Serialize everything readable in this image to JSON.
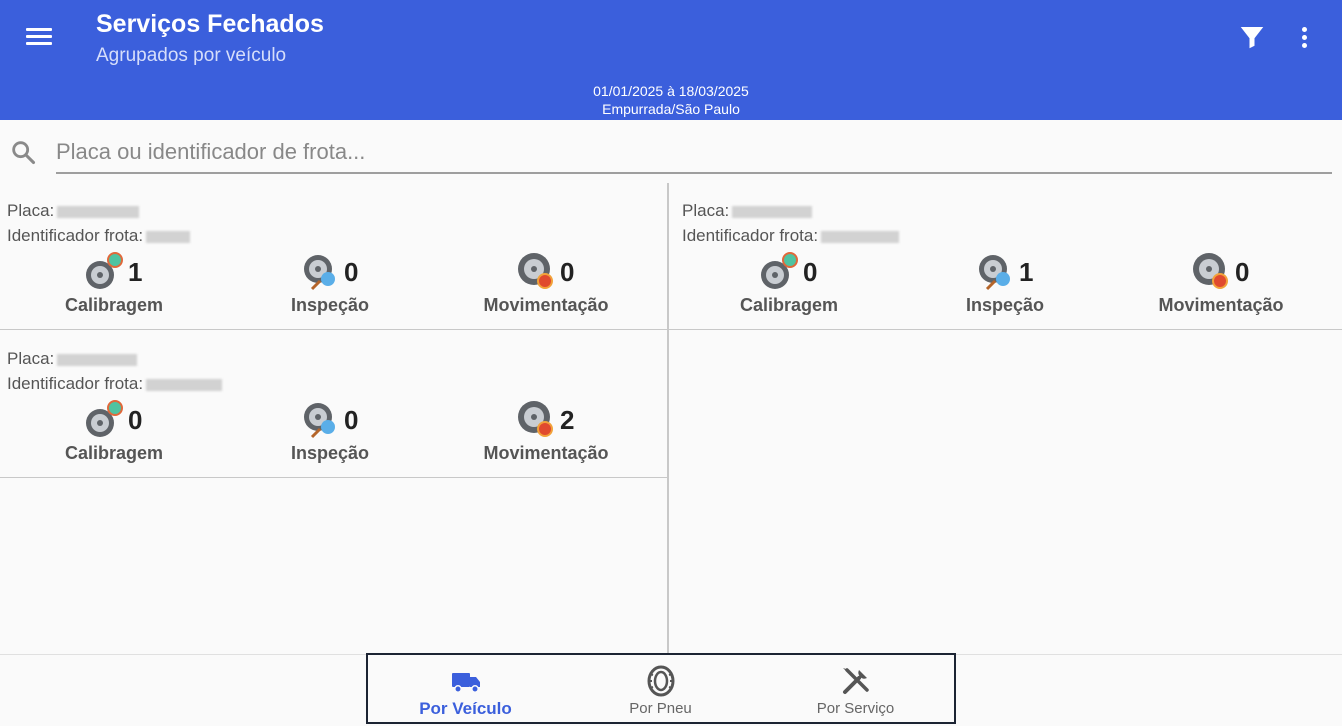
{
  "header": {
    "title": "Serviços Fechados",
    "subtitle": "Agrupados por veículo",
    "period": "01/01/2025 à 18/03/2025",
    "location": "Empurrada/São Paulo",
    "menu_icon": "menu-icon",
    "filter_icon": "filter-icon",
    "more_icon": "more-vert-icon"
  },
  "search": {
    "placeholder": "Placa ou identificador de frota...",
    "value": "",
    "icon": "search-icon"
  },
  "labels": {
    "placa": "Placa:",
    "identificador": "Identificador frota:"
  },
  "vehicles": [
    {
      "stats": [
        {
          "label": "Calibragem",
          "count": "1"
        },
        {
          "label": "Inspeção",
          "count": "0"
        },
        {
          "label": "Movimentação",
          "count": "0"
        }
      ]
    },
    {
      "stats": [
        {
          "label": "Calibragem",
          "count": "0"
        },
        {
          "label": "Inspeção",
          "count": "1"
        },
        {
          "label": "Movimentação",
          "count": "0"
        }
      ]
    },
    {
      "stats": [
        {
          "label": "Calibragem",
          "count": "0"
        },
        {
          "label": "Inspeção",
          "count": "0"
        },
        {
          "label": "Movimentação",
          "count": "2"
        }
      ]
    }
  ],
  "bottom_nav": {
    "items": [
      {
        "label": "Por Veículo",
        "icon": "truck-icon",
        "active": true
      },
      {
        "label": "Por Pneu",
        "icon": "tire-icon",
        "active": false
      },
      {
        "label": "Por Serviço",
        "icon": "tools-icon",
        "active": false
      }
    ]
  },
  "colors": {
    "primary": "#3b5fdc",
    "background": "#fafafa",
    "divider": "#c8c8c8"
  }
}
